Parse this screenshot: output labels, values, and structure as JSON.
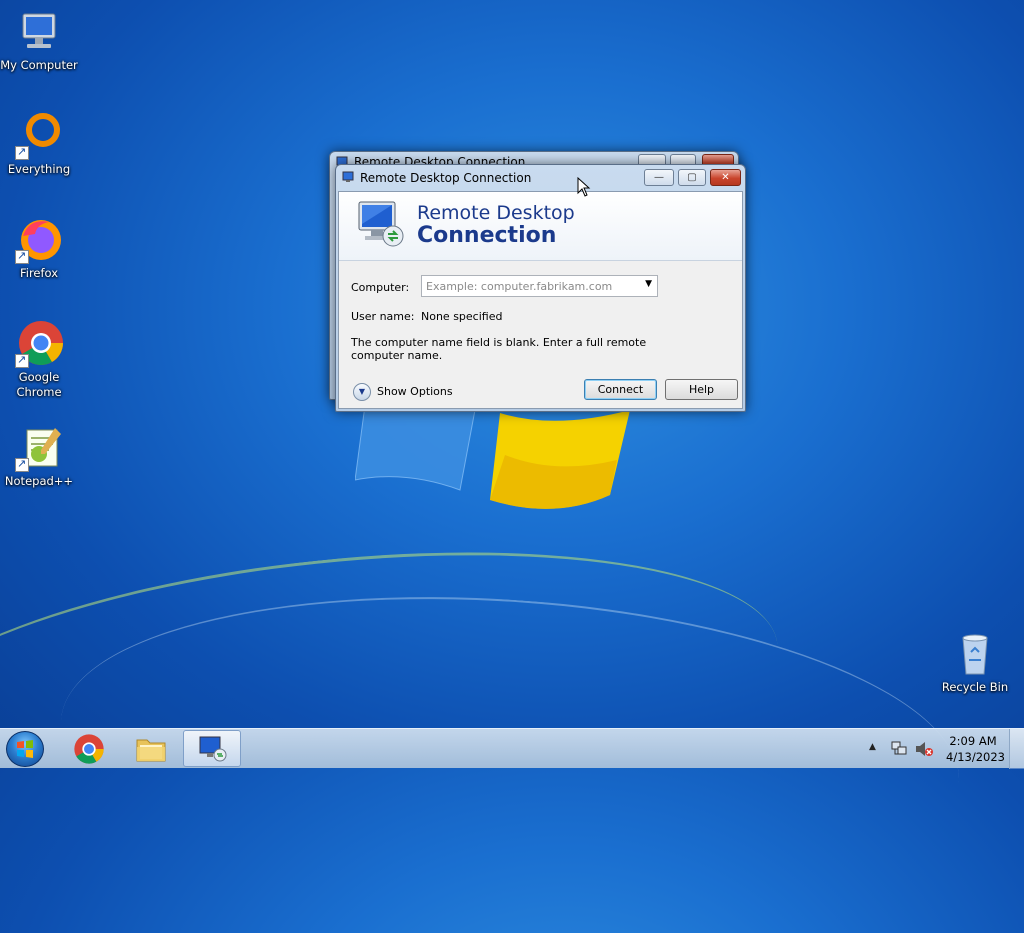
{
  "desktop": {
    "icons": [
      {
        "label": "My Computer",
        "icon": "computer-icon"
      },
      {
        "label": "Everything",
        "icon": "everything-search-icon"
      },
      {
        "label": "Firefox",
        "icon": "firefox-icon"
      },
      {
        "label": "Google Chrome",
        "icon": "chrome-icon"
      },
      {
        "label": "Notepad++",
        "icon": "notepadpp-icon"
      },
      {
        "label": "Recycle Bin",
        "icon": "recycle-bin-icon"
      }
    ]
  },
  "back_window": {
    "title": "Remote Desktop Connection"
  },
  "dialog": {
    "title": "Remote Desktop Connection",
    "banner_line1": "Remote Desktop",
    "banner_line2": "Connection",
    "computer_label": "Computer:",
    "computer_placeholder": "Example: computer.fabrikam.com",
    "username_label": "User name:",
    "username_value": "None specified",
    "message": "The computer name field is blank. Enter a full remote computer name.",
    "show_options": "Show Options",
    "connect_button": "Connect",
    "help_button": "Help",
    "minimize": "—",
    "maximize": "▢",
    "close": "✕"
  },
  "taskbar": {
    "pinned": [
      {
        "name": "chrome",
        "icon": "chrome-icon"
      },
      {
        "name": "file-explorer",
        "icon": "folder-icon"
      },
      {
        "name": "remote-desktop",
        "icon": "remote-desktop-icon",
        "active": true
      }
    ],
    "tray_arrow": "▲",
    "time": "2:09 AM",
    "date": "4/13/2023"
  },
  "colors": {
    "desktop_blue": "#1a6fd0",
    "banner_text": "#1b3a8c",
    "close_red": "#c9452d"
  }
}
